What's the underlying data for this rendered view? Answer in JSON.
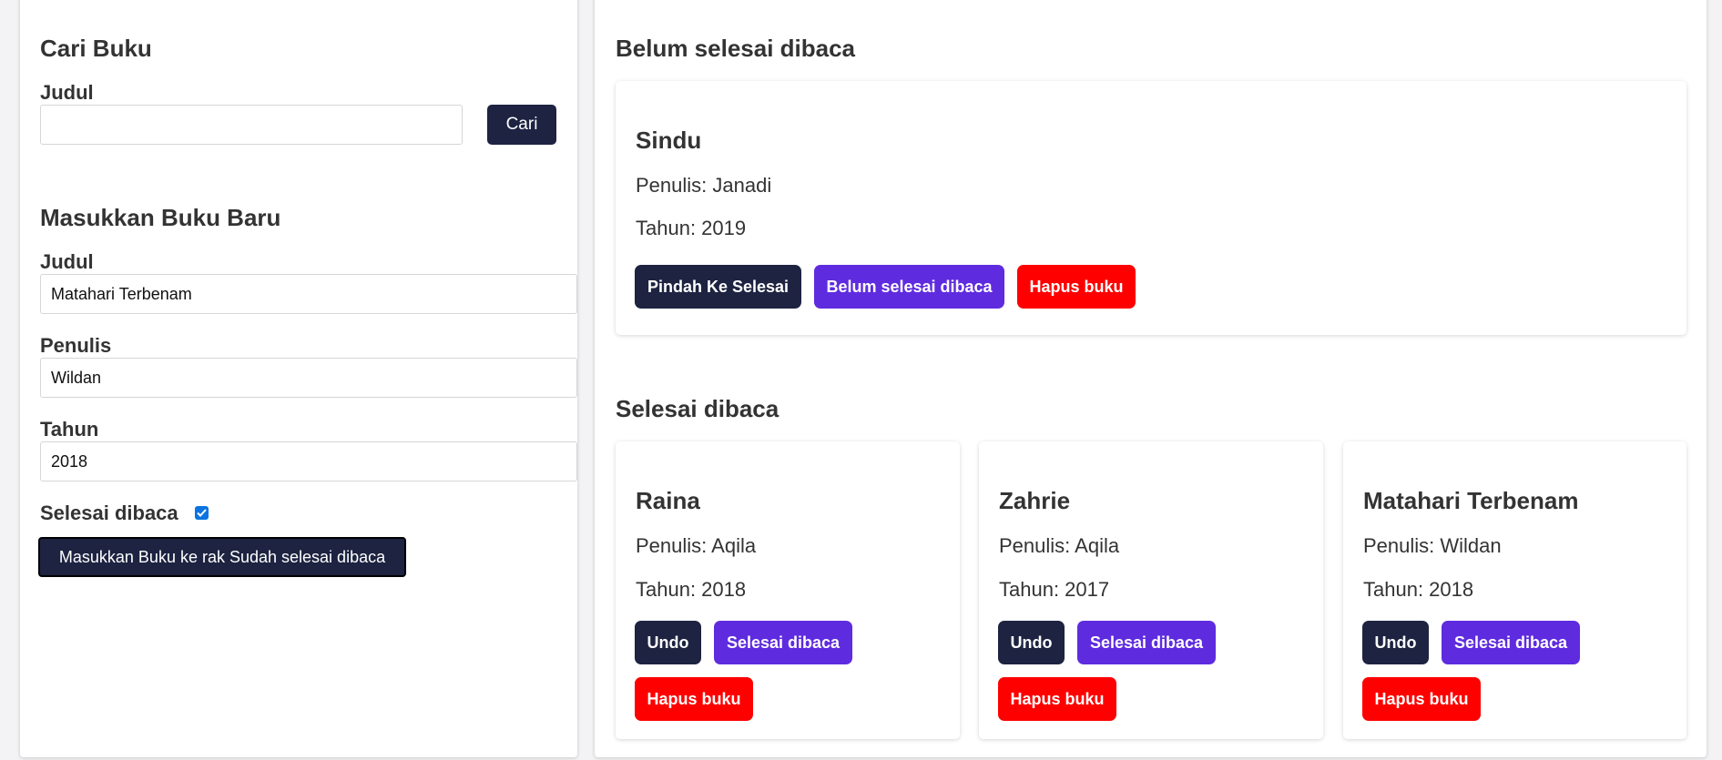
{
  "search": {
    "title": "Cari Buku",
    "judul_label": "Judul",
    "judul_value": "",
    "button_label": "Cari"
  },
  "add_form": {
    "title": "Masukkan Buku Baru",
    "judul_label": "Judul",
    "judul_value": "Matahari Terbenam",
    "penulis_label": "Penulis",
    "penulis_value": "Wildan",
    "tahun_label": "Tahun",
    "tahun_value": "2018",
    "selesai_label": "Selesai dibaca",
    "selesai_checked": true,
    "submit_label": "Masukkan Buku ke rak Sudah selesai dibaca"
  },
  "unfinished": {
    "title": "Belum selesai dibaca",
    "books": [
      {
        "title": "Sindu",
        "author": "Penulis: Janadi",
        "year": "Tahun: 2019",
        "move_label": "Pindah Ke Selesai",
        "status_label": "Belum selesai dibaca",
        "delete_label": "Hapus buku"
      }
    ]
  },
  "finished": {
    "title": "Selesai dibaca",
    "books": [
      {
        "title": "Raina",
        "author": "Penulis: Aqila",
        "year": "Tahun: 2018",
        "undo_label": "Undo",
        "status_label": "Selesai dibaca",
        "delete_label": "Hapus buku"
      },
      {
        "title": "Zahrie",
        "author": "Penulis: Aqila",
        "year": "Tahun: 2017",
        "undo_label": "Undo",
        "status_label": "Selesai dibaca",
        "delete_label": "Hapus buku"
      },
      {
        "title": "Matahari Terbenam",
        "author": "Penulis: Wildan",
        "year": "Tahun: 2018",
        "undo_label": "Undo",
        "status_label": "Selesai dibaca",
        "delete_label": "Hapus buku"
      }
    ]
  },
  "colors": {
    "navy": "#1d2341",
    "purple": "#5f2bdf",
    "red": "#ff0000",
    "checkbox": "#0b74e0"
  }
}
